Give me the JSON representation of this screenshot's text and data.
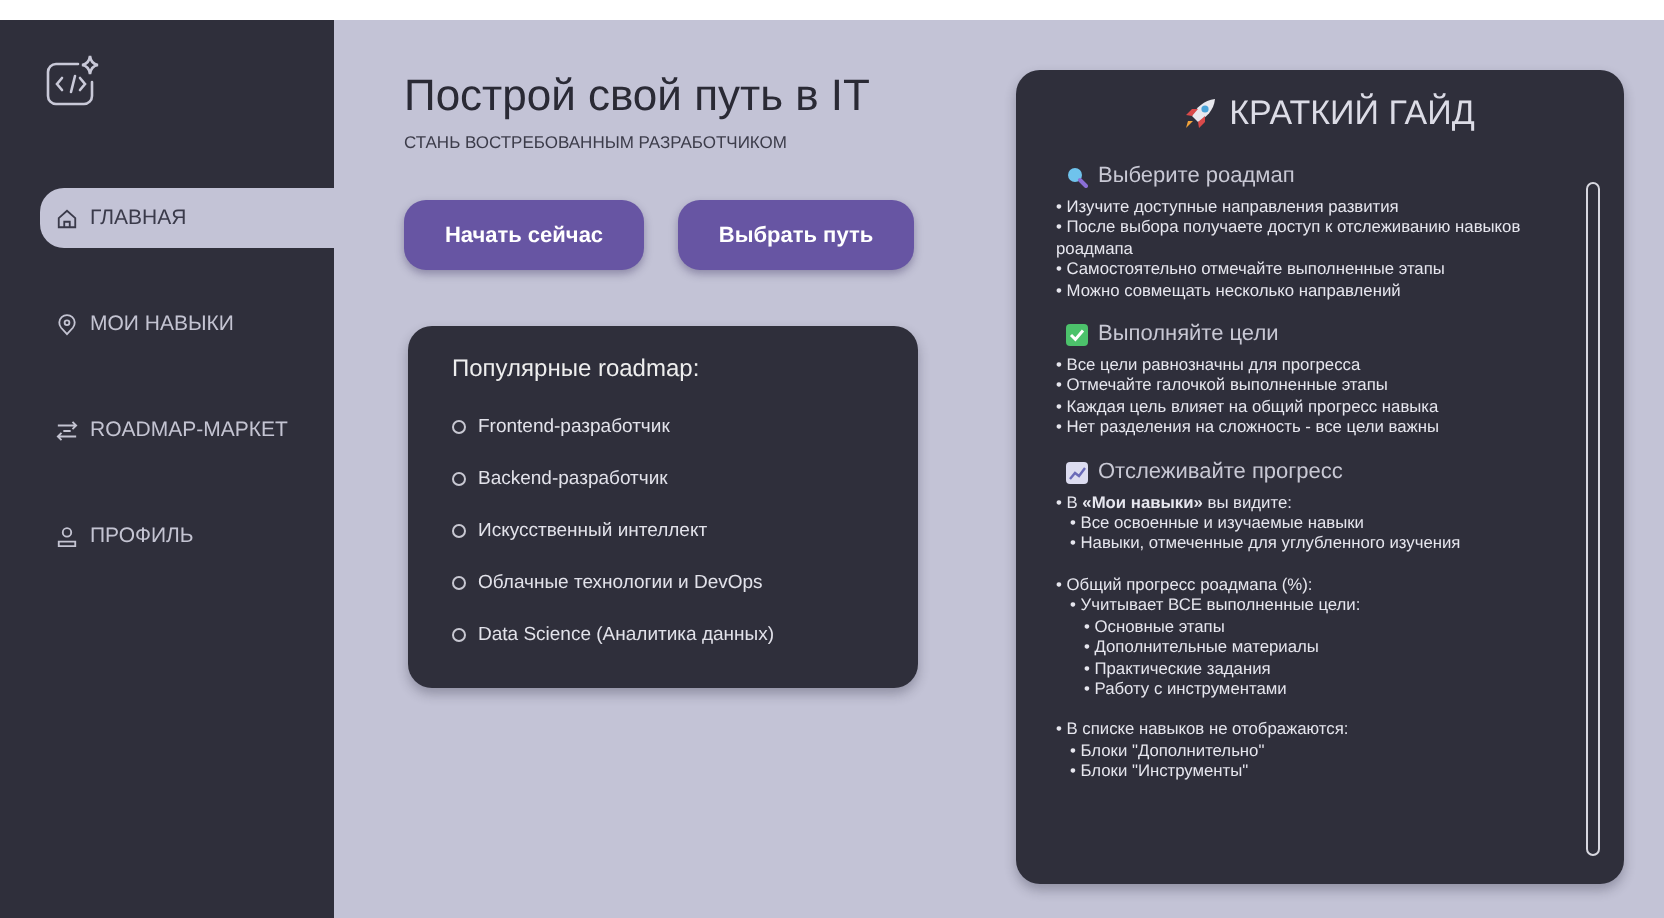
{
  "sidebar": {
    "items": [
      {
        "label": "ГЛАВНАЯ",
        "kind": "home",
        "selected": true
      },
      {
        "label": "МОИ НАВЫКИ",
        "kind": "pin",
        "selected": false
      },
      {
        "label": "ROADMAP-МАРКЕТ",
        "kind": "route",
        "selected": false
      },
      {
        "label": "ПРОФИЛЬ",
        "kind": "user",
        "selected": false
      }
    ]
  },
  "hero": {
    "title": "Построй свой путь в IT",
    "subtitle": "СТАНЬ ВОСТРЕБОВАННЫМ РАЗРАБОТЧИКОМ",
    "buttons": [
      "Начать сейчас",
      "Выбрать путь"
    ]
  },
  "popular": {
    "title": "Популярные roadmap:",
    "items": [
      "Frontend-разработчик",
      "Backend-разработчик",
      "Искусственный интеллект",
      "Облачные технологии и DevOps",
      "Data Science (Аналитика данных)"
    ]
  },
  "guide": {
    "title": "КРАТКИЙ ГАЙД",
    "sections": [
      {
        "kind": "search",
        "title": "Выберите роадмап",
        "items": [
          {
            "text": "• Изучите доступные направления развития"
          },
          {
            "text": "• После выбора получаете доступ к отслеживанию навыков роадмапа"
          },
          {
            "text": "• Самостоятельно отмечайте выполненные этапы"
          },
          {
            "text": "• Можно совмещать несколько направлений"
          }
        ]
      },
      {
        "kind": "check",
        "title": "Выполняйте цели",
        "items": [
          {
            "text": "• Все цели равнозначны для прогресса"
          },
          {
            "text": "• Отмечайте галочкой выполненные этапы"
          },
          {
            "text": "• Каждая цель влияет на общий прогресс навыка"
          },
          {
            "text": "• Нет разделения на сложность - все цели важны"
          }
        ]
      },
      {
        "kind": "chart",
        "title": "Отслеживайте прогресс",
        "items": [
          {
            "text": "• В **«Мои навыки»** вы видите:",
            "children": [
              {
                "text": "• Все освоенные и изучаемые навыки"
              },
              {
                "text": "• Навыки, отмеченные для углубленного изучения"
              }
            ]
          },
          {
            "text": "• Общий прогресс роадмапа (%):",
            "children": [
              {
                "text": "• Учитывает ВСЕ выполненные цели:",
                "children": [
                  {
                    "text": "• Основные этапы"
                  },
                  {
                    "text": "• Дополнительные материалы"
                  },
                  {
                    "text": "• Практические задания"
                  },
                  {
                    "text": "• Работу с инструментами"
                  }
                ]
              }
            ]
          },
          {
            "text": "• В списке навыков не отображаются:",
            "children": [
              {
                "text": "• Блоки \"Дополнительно\""
              },
              {
                "text": "• Блоки \"Инструменты\""
              }
            ]
          }
        ]
      }
    ]
  }
}
